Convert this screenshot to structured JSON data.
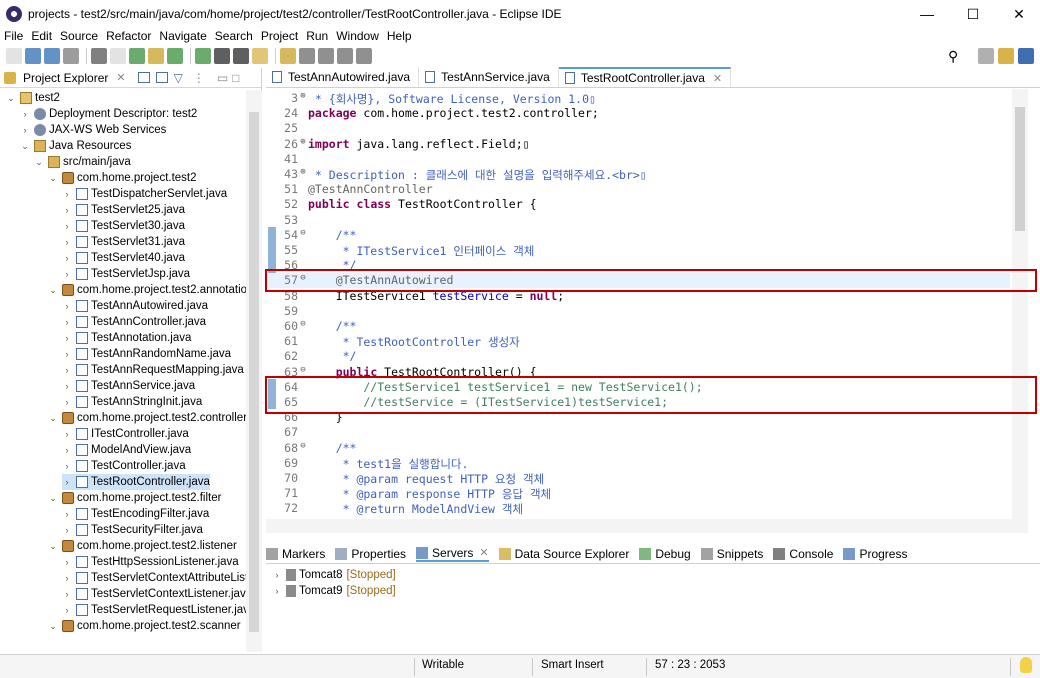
{
  "window": {
    "title": "projects - test2/src/main/java/com/home/project/test2/controller/TestRootController.java - Eclipse IDE",
    "minimize": "—",
    "maximize": "☐",
    "close": "✕"
  },
  "menu": [
    "File",
    "Edit",
    "Source",
    "Refactor",
    "Navigate",
    "Search",
    "Project",
    "Run",
    "Window",
    "Help"
  ],
  "project_explorer": {
    "title": "Project Explorer",
    "tree": [
      {
        "label": "test2",
        "icon": "project-icon",
        "expanded": true
      },
      {
        "label": "Deployment Descriptor: test2",
        "icon": "descriptor-icon",
        "expanded": false
      },
      {
        "label": "JAX-WS Web Services",
        "icon": "webservice-icon",
        "expanded": false
      },
      {
        "label": "Java Resources",
        "icon": "resources-icon",
        "expanded": true
      },
      {
        "label": "src/main/java",
        "icon": "source-folder-icon",
        "expanded": true
      },
      {
        "label": "com.home.project.test2",
        "icon": "package-icon",
        "expanded": true
      },
      {
        "label": "TestDispatcherServlet.java",
        "icon": "java-file-icon"
      },
      {
        "label": "TestServlet25.java",
        "icon": "java-file-icon"
      },
      {
        "label": "TestServlet30.java",
        "icon": "java-file-icon"
      },
      {
        "label": "TestServlet31.java",
        "icon": "java-file-icon"
      },
      {
        "label": "TestServlet40.java",
        "icon": "java-file-icon"
      },
      {
        "label": "TestServletJsp.java",
        "icon": "java-file-icon"
      },
      {
        "label": "com.home.project.test2.annotation",
        "icon": "package-icon",
        "expanded": true
      },
      {
        "label": "TestAnnAutowired.java",
        "icon": "java-file-icon"
      },
      {
        "label": "TestAnnController.java",
        "icon": "java-file-icon"
      },
      {
        "label": "TestAnnotation.java",
        "icon": "java-file-icon"
      },
      {
        "label": "TestAnnRandomName.java",
        "icon": "java-file-icon"
      },
      {
        "label": "TestAnnRequestMapping.java",
        "icon": "java-file-icon"
      },
      {
        "label": "TestAnnService.java",
        "icon": "java-file-icon"
      },
      {
        "label": "TestAnnStringInit.java",
        "icon": "java-file-icon"
      },
      {
        "label": "com.home.project.test2.controller",
        "icon": "package-icon",
        "expanded": true
      },
      {
        "label": "ITestController.java",
        "icon": "java-file-icon"
      },
      {
        "label": "ModelAndView.java",
        "icon": "java-file-icon"
      },
      {
        "label": "TestController.java",
        "icon": "java-file-icon"
      },
      {
        "label": "TestRootController.java",
        "icon": "java-file-icon",
        "selected": true
      },
      {
        "label": "com.home.project.test2.filter",
        "icon": "package-icon",
        "expanded": true
      },
      {
        "label": "TestEncodingFilter.java",
        "icon": "java-file-icon"
      },
      {
        "label": "TestSecurityFilter.java",
        "icon": "java-file-icon"
      },
      {
        "label": "com.home.project.test2.listener",
        "icon": "package-icon",
        "expanded": true
      },
      {
        "label": "TestHttpSessionListener.java",
        "icon": "java-file-icon"
      },
      {
        "label": "TestServletContextAttributeListe",
        "icon": "java-file-icon"
      },
      {
        "label": "TestServletContextListener.java",
        "icon": "java-file-icon"
      },
      {
        "label": "TestServletRequestListener.java",
        "icon": "java-file-icon"
      },
      {
        "label": "com.home.project.test2.scanner",
        "icon": "package-icon",
        "expanded": true
      }
    ]
  },
  "editor_tabs": [
    {
      "label": "TestAnnAutowired.java",
      "active": false
    },
    {
      "label": "TestAnnService.java",
      "active": false
    },
    {
      "label": "TestRootController.java",
      "active": true
    }
  ],
  "code_lines": [
    {
      "n": "3",
      "fold": "⊕",
      "text": " * {회사명}, Software License, Version 1.0▯",
      "style": "jd"
    },
    {
      "n": "24",
      "fold": "",
      "text": "package com.home.project.test2.controller;",
      "style": "pkg"
    },
    {
      "n": "25",
      "fold": "",
      "text": "",
      "style": ""
    },
    {
      "n": "26",
      "fold": "⊕",
      "text": "import java.lang.reflect.Field;▯",
      "style": "imp"
    },
    {
      "n": "41",
      "fold": "",
      "text": "",
      "style": ""
    },
    {
      "n": "43",
      "fold": "⊕",
      "text": " * Description : 클래스에 대한 설명을 입력해주세요.<br>▯",
      "style": "jd"
    },
    {
      "n": "51",
      "fold": "",
      "text": "@TestAnnController",
      "style": "an"
    },
    {
      "n": "52",
      "fold": "",
      "text": "public class TestRootController {",
      "style": "cls"
    },
    {
      "n": "53",
      "fold": "",
      "text": "",
      "style": ""
    },
    {
      "n": "54",
      "fold": "⊖",
      "text": "    /**",
      "style": "jd"
    },
    {
      "n": "55",
      "fold": "",
      "text": "     * ITestService1 인터페이스 객체",
      "style": "jd"
    },
    {
      "n": "56",
      "fold": "",
      "text": "     */",
      "style": "jd"
    },
    {
      "n": "57",
      "fold": "⊖",
      "text": "    @TestAnnAutowired ",
      "style": "an",
      "current": true
    },
    {
      "n": "58",
      "fold": "",
      "text": "    ITestService1 testService = null;",
      "style": "fielddecl"
    },
    {
      "n": "59",
      "fold": "",
      "text": "",
      "style": ""
    },
    {
      "n": "60",
      "fold": "⊖",
      "text": "    /**",
      "style": "jd"
    },
    {
      "n": "61",
      "fold": "",
      "text": "     * TestRootController 생성자",
      "style": "jd"
    },
    {
      "n": "62",
      "fold": "",
      "text": "     */",
      "style": "jd"
    },
    {
      "n": "63",
      "fold": "⊖",
      "text": "    public TestRootController() {",
      "style": "ctor"
    },
    {
      "n": "64",
      "fold": "",
      "text": "        //TestService1 testService1 = new TestService1();",
      "style": "cm"
    },
    {
      "n": "65",
      "fold": "",
      "text": "        //testService = (ITestService1)testService1;",
      "style": "cm"
    },
    {
      "n": "66",
      "fold": "",
      "text": "    }",
      "style": ""
    },
    {
      "n": "67",
      "fold": "",
      "text": "",
      "style": ""
    },
    {
      "n": "68",
      "fold": "⊖",
      "text": "    /**",
      "style": "jd"
    },
    {
      "n": "69",
      "fold": "",
      "text": "     * test1을 실행합니다.",
      "style": "jd"
    },
    {
      "n": "70",
      "fold": "",
      "text": "     * @param request HTTP 요청 객체",
      "style": "jd"
    },
    {
      "n": "71",
      "fold": "",
      "text": "     * @param response HTTP 응답 객체",
      "style": "jd"
    },
    {
      "n": "72",
      "fold": "",
      "text": "     * @return ModelAndView 객체",
      "style": "jd"
    }
  ],
  "bottom_tabs": [
    {
      "label": "Markers",
      "icon": "markers-icon"
    },
    {
      "label": "Properties",
      "icon": "properties-icon"
    },
    {
      "label": "Servers",
      "icon": "servers-icon",
      "active": true
    },
    {
      "label": "Data Source Explorer",
      "icon": "datasource-icon"
    },
    {
      "label": "Debug",
      "icon": "debug-icon"
    },
    {
      "label": "Snippets",
      "icon": "snippets-icon"
    },
    {
      "label": "Console",
      "icon": "console-icon"
    },
    {
      "label": "Progress",
      "icon": "progress-icon"
    }
  ],
  "servers": [
    {
      "name": "Tomcat8",
      "state": "[Stopped]"
    },
    {
      "name": "Tomcat9",
      "state": "[Stopped]"
    }
  ],
  "status": {
    "mode": "Writable",
    "insert": "Smart Insert",
    "position": "57 : 23 : 2053"
  }
}
